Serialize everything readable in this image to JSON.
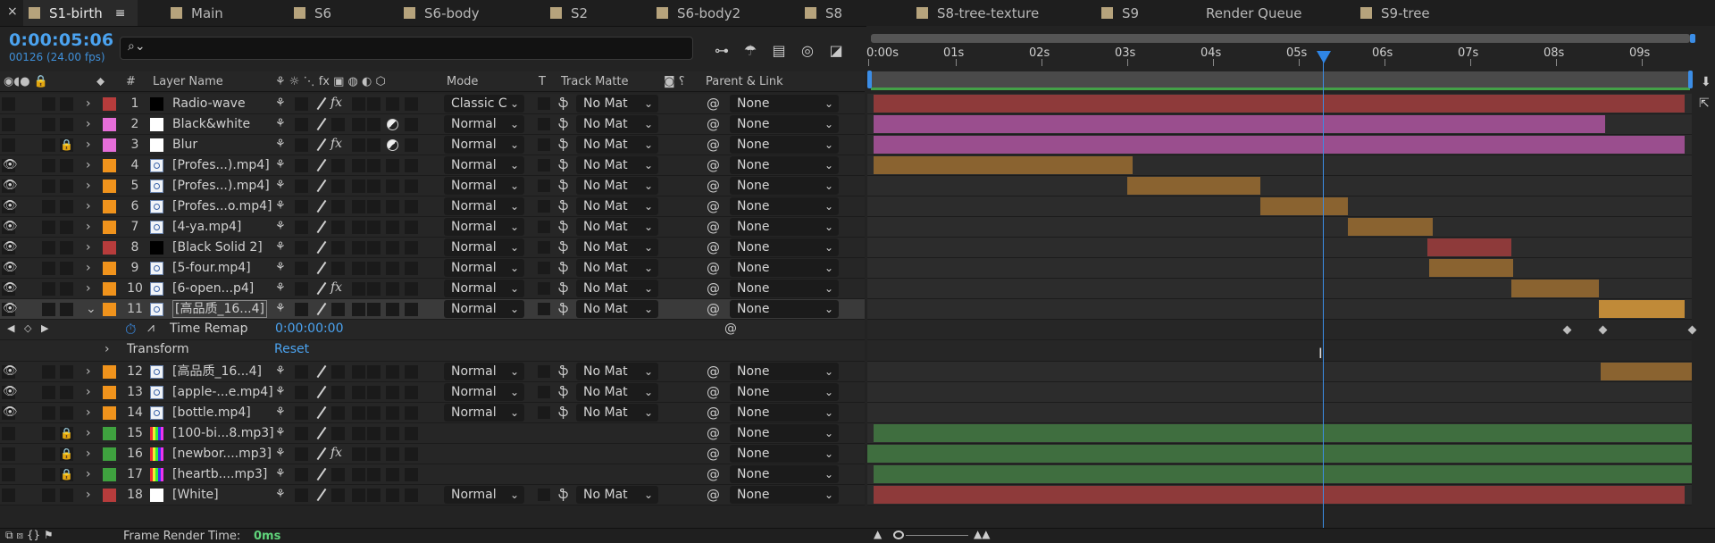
{
  "tabs": [
    {
      "label": "S1-birth",
      "active": true
    },
    {
      "label": "Main"
    },
    {
      "label": "S6"
    },
    {
      "label": "S6-body"
    },
    {
      "label": "S2"
    },
    {
      "label": "S6-body2"
    },
    {
      "label": "S8"
    },
    {
      "label": "S8-tree-texture"
    },
    {
      "label": "S9"
    },
    {
      "label": "Render Queue"
    },
    {
      "label": "S9-tree"
    }
  ],
  "header": {
    "timecode": "0:00:05:06",
    "frame_info": "00126 (24.00 fps)",
    "search_placeholder": ""
  },
  "columns": {
    "layer_name": "Layer Name",
    "hash": "#",
    "mode": "Mode",
    "t": "T",
    "track_matte": "Track Matte",
    "parent_link": "Parent & Link"
  },
  "ruler": {
    "labels": [
      "0:00s",
      "01s",
      "02s",
      "03s",
      "04s",
      "05s",
      "06s",
      "07s",
      "08s",
      "09s"
    ]
  },
  "layers": [
    {
      "num": "1",
      "name": "Radio-wave",
      "label_color": "#b73c3c",
      "thumb": "black",
      "mode": "Classic C",
      "matte": "No Mat",
      "parent": "None",
      "fx": true,
      "eye": false,
      "lock": false
    },
    {
      "num": "2",
      "name": "Black&white",
      "label_color": "#e66ed9",
      "thumb": "white",
      "mode": "Normal",
      "matte": "No Mat",
      "parent": "None",
      "halfc": true,
      "eye": false,
      "lock": false
    },
    {
      "num": "3",
      "name": "Blur",
      "label_color": "#e66ed9",
      "thumb": "white",
      "mode": "Normal",
      "matte": "No Mat",
      "parent": "None",
      "fx": true,
      "halfc": true,
      "eye": false,
      "lock": true
    },
    {
      "num": "4",
      "name": "[Profes...).mp4]",
      "label_color": "#f0931c",
      "thumb": "media",
      "mode": "Normal",
      "matte": "No Mat",
      "parent": "None",
      "eye": true,
      "lock": false
    },
    {
      "num": "5",
      "name": "[Profes...).mp4]",
      "label_color": "#f0931c",
      "thumb": "media",
      "mode": "Normal",
      "matte": "No Mat",
      "parent": "None",
      "eye": true,
      "lock": false
    },
    {
      "num": "6",
      "name": "[Profes...o.mp4]",
      "label_color": "#f0931c",
      "thumb": "media",
      "mode": "Normal",
      "matte": "No Mat",
      "parent": "None",
      "eye": true,
      "lock": false
    },
    {
      "num": "7",
      "name": "[4-ya.mp4]",
      "label_color": "#f0931c",
      "thumb": "media",
      "mode": "Normal",
      "matte": "No Mat",
      "parent": "None",
      "eye": true,
      "lock": false
    },
    {
      "num": "8",
      "name": "[Black Solid 2]",
      "label_color": "#b73c3c",
      "thumb": "black",
      "mode": "Normal",
      "matte": "No Mat",
      "parent": "None",
      "eye": true,
      "lock": false
    },
    {
      "num": "9",
      "name": "[5-four.mp4]",
      "label_color": "#f0931c",
      "thumb": "media",
      "mode": "Normal",
      "matte": "No Mat",
      "parent": "None",
      "eye": true,
      "lock": false
    },
    {
      "num": "10",
      "name": "[6-open...p4]",
      "label_color": "#f0931c",
      "thumb": "media",
      "mode": "Normal",
      "matte": "No Mat",
      "parent": "None",
      "fx": true,
      "eye": true,
      "lock": false
    },
    {
      "num": "11",
      "name": "[高品质_16...4]",
      "label_color": "#f0931c",
      "thumb": "media",
      "mode": "Normal",
      "matte": "No Mat",
      "parent": "None",
      "eye": true,
      "lock": false,
      "selected": true,
      "expanded": true
    },
    {
      "num": "12",
      "name": "[高品质_16...4]",
      "label_color": "#f0931c",
      "thumb": "media",
      "mode": "Normal",
      "matte": "No Mat",
      "parent": "None",
      "eye": true,
      "lock": false
    },
    {
      "num": "13",
      "name": "[apple-...e.mp4]",
      "label_color": "#f0931c",
      "thumb": "media",
      "mode": "Normal",
      "matte": "No Mat",
      "parent": "None",
      "eye": true,
      "lock": false
    },
    {
      "num": "14",
      "name": "[bottle.mp4]",
      "label_color": "#f0931c",
      "thumb": "media",
      "mode": "Normal",
      "matte": "No Mat",
      "parent": "None",
      "eye": true,
      "lock": false
    },
    {
      "num": "15",
      "name": "[100-bi...8.mp3]",
      "label_color": "#3fa23f",
      "thumb": "audio",
      "parent": "None",
      "audio": true,
      "lock": true
    },
    {
      "num": "16",
      "name": "[newbor....mp3]",
      "label_color": "#3fa23f",
      "thumb": "audio",
      "parent": "None",
      "audio": true,
      "fx": true,
      "lock": true
    },
    {
      "num": "17",
      "name": "[heartb....mp3]",
      "label_color": "#3fa23f",
      "thumb": "audio",
      "parent": "None",
      "audio": true,
      "lock": true
    },
    {
      "num": "18",
      "name": "[White]",
      "label_color": "#b73c3c",
      "thumb": "white",
      "mode": "Normal",
      "matte": "No Mat",
      "parent": "None",
      "eye": false,
      "lock": false
    }
  ],
  "time_remap": {
    "label": "Time Remap",
    "value": "0:00:00:00"
  },
  "transform": {
    "label": "Transform",
    "reset": "Reset"
  },
  "bottom": {
    "label": "Frame Render Time:",
    "value": "0ms"
  },
  "colors": {
    "accent": "#3b8de6",
    "bar_red": "#8e3a3a",
    "bar_pink": "#9a4e8e",
    "bar_orange": "#8a6330",
    "bar_green": "#3f6e3f"
  }
}
